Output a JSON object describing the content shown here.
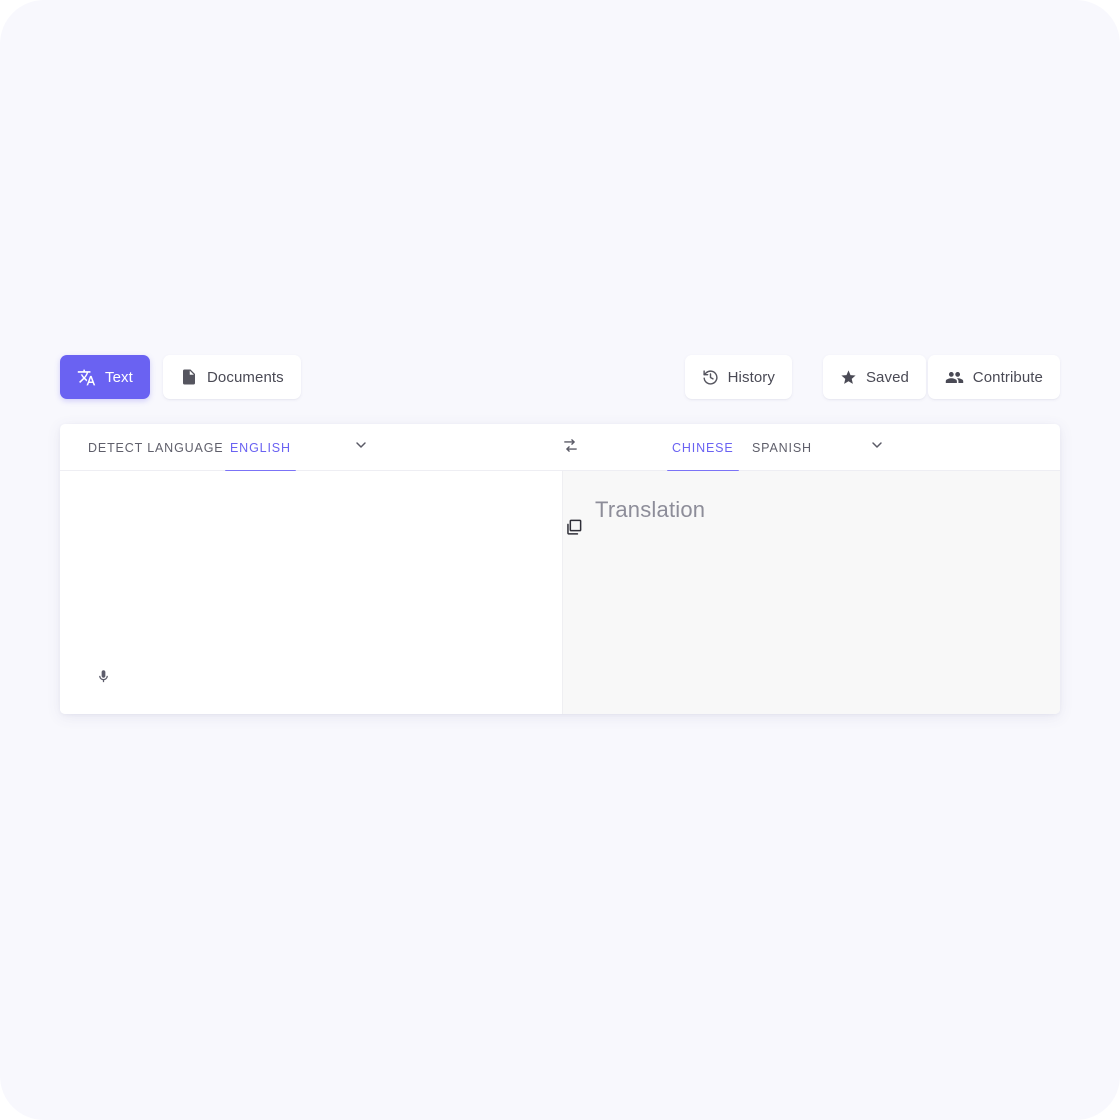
{
  "theme": {
    "accent": "#6a62f2",
    "accent_light": "#7b73f7",
    "page_background": "#f8f8fd",
    "card_background": "#ffffff",
    "target_pane_background": "#f8f8f8",
    "text_primary": "#4a4a55",
    "text_muted": "#8d8d99"
  },
  "toolbar": {
    "left_buttons": [
      {
        "label": "Text",
        "icon": "translate-icon",
        "active": true
      },
      {
        "label": "Documents",
        "icon": "document-icon",
        "active": false
      }
    ],
    "right_buttons": [
      {
        "label": "History",
        "icon": "history-icon"
      },
      {
        "label": "Saved",
        "icon": "star-icon"
      },
      {
        "label": "Contribute",
        "icon": "people-icon"
      }
    ]
  },
  "translator": {
    "source": {
      "options": [
        {
          "label": "DETECT LANGUAGE",
          "active": false
        },
        {
          "label": "ENGLISH",
          "active": true
        }
      ],
      "dropdown_icon": "chevron-down-icon",
      "input_value": "",
      "input_placeholder": "",
      "mic_icon": "microphone-icon"
    },
    "swap": {
      "icon": "swap-horizontal-icon"
    },
    "target": {
      "options": [
        {
          "label": "CHINESE",
          "active": true
        },
        {
          "label": "SPANISH",
          "active": false
        }
      ],
      "dropdown_icon": "chevron-down-icon",
      "placeholder": "Translation",
      "copy_icon": "copy-icon"
    }
  }
}
